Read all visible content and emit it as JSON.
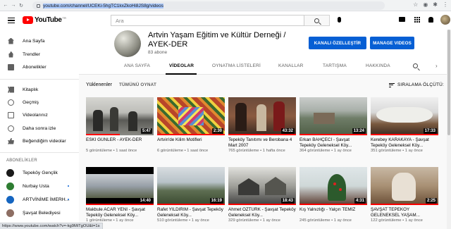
{
  "browser": {
    "url": "youtube.com/channel/UCEKi-5hgTC1kxZkoHi8JS8g/videos"
  },
  "masthead": {
    "logo_text": "YouTube",
    "country_code": "TR",
    "search_placeholder": "Ara"
  },
  "sidebar": {
    "items": [
      {
        "label": "Ana Sayfa",
        "icon": "home-icon"
      },
      {
        "label": "Trendler",
        "icon": "trending-icon"
      },
      {
        "label": "Abonelikler",
        "icon": "subscriptions-icon"
      },
      {
        "label": "Kitaplık",
        "icon": "library-icon"
      },
      {
        "label": "Geçmiş",
        "icon": "history-icon"
      },
      {
        "label": "Videolarınız",
        "icon": "your-videos-icon"
      },
      {
        "label": "Daha sonra izle",
        "icon": "watch-later-icon"
      },
      {
        "label": "Beğendiğim videolar",
        "icon": "liked-videos-icon"
      }
    ],
    "subscriptions_heading": "ABONELİKLER",
    "subscriptions": [
      {
        "label": "Tepeköy Gençlik",
        "color": "#1a1a1a"
      },
      {
        "label": "Nurbay Usta",
        "color": "#2e7d32"
      },
      {
        "label": "ARTVİNİME İMERH...",
        "color": "#1565c0"
      },
      {
        "label": "Şavşat Belediyesi",
        "color": "#8d6e63"
      }
    ]
  },
  "channel": {
    "title": "Artvin Yaşam Eğitim ve Kültür Derneği / AYEK-DER",
    "subscribers": "83 abone",
    "customize_button": "KANALI ÖZELLEŞTİR",
    "manage_button": "MANAGE VIDEOS",
    "tabs": [
      "ANA SAYFA",
      "VİDEOLAR",
      "OYNATMA LİSTELERİ",
      "KANALLAR",
      "TARTIŞMA",
      "HAKKINDA"
    ],
    "active_tab": "VİDEOLAR"
  },
  "uploads": {
    "heading": "Yüklenenler",
    "play_all": "TÜMÜNÜ OYNAT",
    "sort_label": "SIRALAMA ÖLÇÜTÜ:"
  },
  "videos": [
    {
      "title": "ESKİ GÜNLER - AYEK-DER",
      "meta": "5 görüntüleme • 1 saat önce",
      "duration": "5:47"
    },
    {
      "title": "Artvin'de Kilim Motifleri",
      "meta": "6 görüntüleme • 1 saat önce",
      "duration": "2:30"
    },
    {
      "title": "Tepeköy Tanıtımı ve Berobana 4 Mart 2007",
      "meta": "765 görüntüleme • 1 hafta önce",
      "duration": "43:32"
    },
    {
      "title": "Erkan BAHÇECİ - Şavşat Tepeköy Geleneksel Köy...",
      "meta": "364 görüntüleme • 1 ay önce",
      "duration": "13:24"
    },
    {
      "title": "Kerebey KARAKAYA - Şavşat Tepeköy Geleneksel Köy...",
      "meta": "351 görüntüleme • 1 ay önce",
      "duration": "17:33"
    },
    {
      "title": "Makbule ACAR YENİ - Şavşat Tepeköy Geleneksel Köy...",
      "meta": "1 görüntüleme • 1 ay önce",
      "duration": "14:40"
    },
    {
      "title": "Rafet YILDIRIM - Şavşat Tepeköy Geleneksel Köy...",
      "meta": "510 görüntüleme • 1 ay önce",
      "duration": "16:19"
    },
    {
      "title": "Ahmet ÖZTÜRK - Şavşat Tepeköy Geleneksel Köy...",
      "meta": "329 görüntüleme • 1 ay önce",
      "duration": "18:43"
    },
    {
      "title": "Kış Yalnızlığı - Yalçın TEMİZ",
      "meta": "245 görüntüleme • 1 ay önce",
      "duration": "4:31"
    },
    {
      "title": "ŞAVŞAT TEPEKÖY GELENEKSEL YAŞAM...",
      "meta": "122 görüntüleme • 1 ay önce",
      "duration": "2:25"
    }
  ],
  "status_bar": "https://www.youtube.com/watch?v=-kg9MiTgOU&t=1s",
  "colors": {
    "brand_red": "#ff0000",
    "accent_blue": "#065fd4"
  }
}
